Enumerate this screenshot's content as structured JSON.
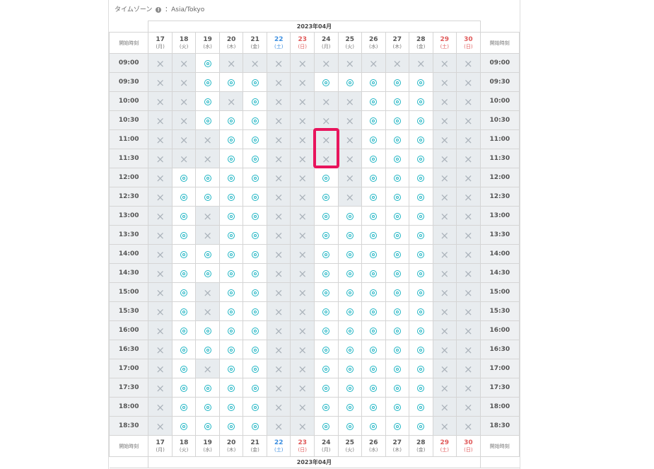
{
  "timezone": {
    "label": "タイムゾーン",
    "sep": "：",
    "value": "Asia/Tokyo"
  },
  "month_label": "2023年04月",
  "header_label": "開始時刻",
  "footer_label": "開始時刻",
  "days": [
    {
      "num": "17",
      "dow": "(月)",
      "kind": "weekday"
    },
    {
      "num": "18",
      "dow": "(火)",
      "kind": "weekday"
    },
    {
      "num": "19",
      "dow": "(水)",
      "kind": "weekday"
    },
    {
      "num": "20",
      "dow": "(木)",
      "kind": "weekday"
    },
    {
      "num": "21",
      "dow": "(金)",
      "kind": "weekday"
    },
    {
      "num": "22",
      "dow": "(土)",
      "kind": "sat"
    },
    {
      "num": "23",
      "dow": "(日)",
      "kind": "sun"
    },
    {
      "num": "24",
      "dow": "(月)",
      "kind": "weekday"
    },
    {
      "num": "25",
      "dow": "(火)",
      "kind": "weekday"
    },
    {
      "num": "26",
      "dow": "(水)",
      "kind": "weekday"
    },
    {
      "num": "27",
      "dow": "(木)",
      "kind": "weekday"
    },
    {
      "num": "28",
      "dow": "(金)",
      "kind": "weekday"
    },
    {
      "num": "29",
      "dow": "(土)",
      "kind": "sun"
    },
    {
      "num": "30",
      "dow": "(日)",
      "kind": "sun"
    }
  ],
  "slots": [
    {
      "time": "09:00",
      "cells": "xxoxxxxxxxxxxx"
    },
    {
      "time": "09:30",
      "cells": "xxoooxxoooooxx"
    },
    {
      "time": "10:00",
      "cells": "xxoxoxxxxoooxx"
    },
    {
      "time": "10:30",
      "cells": "xxoooxxxxoooxx"
    },
    {
      "time": "11:00",
      "cells": "xxxooxxxxoooxx"
    },
    {
      "time": "11:30",
      "cells": "xxxooxxxxoooxx"
    },
    {
      "time": "12:00",
      "cells": "xooooxxoxoooxx"
    },
    {
      "time": "12:30",
      "cells": "xooooxxoxoooxx"
    },
    {
      "time": "13:00",
      "cells": "xoxooxxoooooxx"
    },
    {
      "time": "13:30",
      "cells": "xoxooxxoooooxx"
    },
    {
      "time": "14:00",
      "cells": "xooooxxoooooxx"
    },
    {
      "time": "14:30",
      "cells": "xooooxxoooooxx"
    },
    {
      "time": "15:00",
      "cells": "xoxooxxoooooxx"
    },
    {
      "time": "15:30",
      "cells": "xoxooxxoooooxx"
    },
    {
      "time": "16:00",
      "cells": "xooooxxoooooxx"
    },
    {
      "time": "16:30",
      "cells": "xooooxxoooooxx"
    },
    {
      "time": "17:00",
      "cells": "xoxooxxoooooxx"
    },
    {
      "time": "17:30",
      "cells": "xooooxxoooooxx"
    },
    {
      "time": "18:00",
      "cells": "xooooxxoooooxx"
    },
    {
      "time": "18:30",
      "cells": "xooooxxoooooxx"
    }
  ],
  "symbols": {
    "available": "◎",
    "unavailable": "×"
  },
  "colors": {
    "available": "#1fb5c4",
    "highlight": "#e8145c",
    "saturday": "#3d8fe0",
    "sunday": "#e05a5a"
  }
}
